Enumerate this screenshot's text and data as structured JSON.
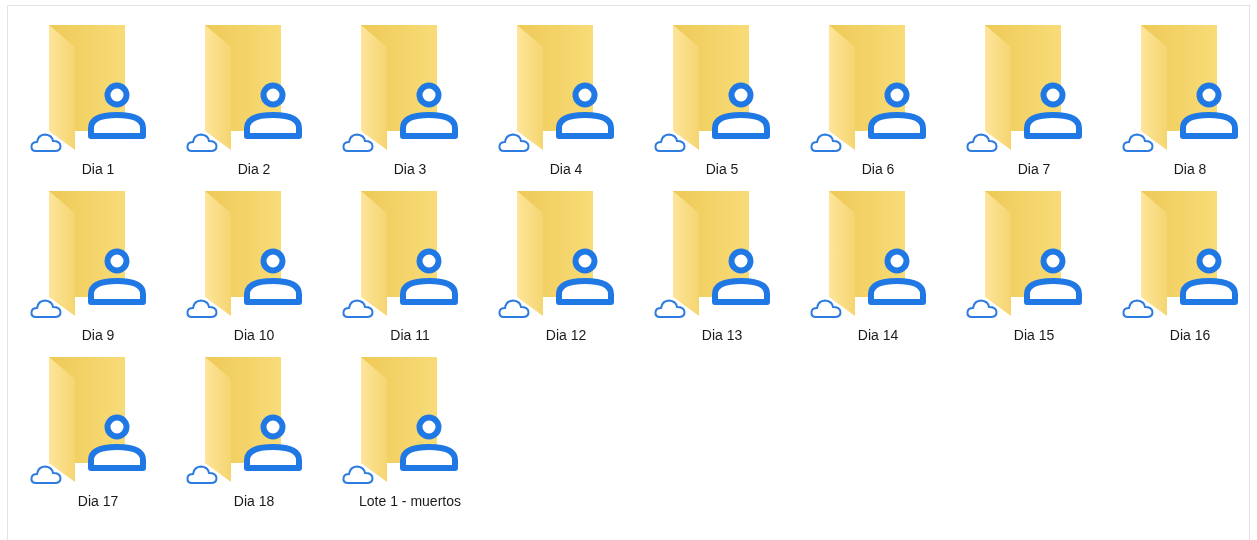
{
  "folders": [
    {
      "label": "Dia 1"
    },
    {
      "label": "Dia 2"
    },
    {
      "label": "Dia 3"
    },
    {
      "label": "Dia 4"
    },
    {
      "label": "Dia 5"
    },
    {
      "label": "Dia 6"
    },
    {
      "label": "Dia 7"
    },
    {
      "label": "Dia 8"
    },
    {
      "label": "Dia 9"
    },
    {
      "label": "Dia 10"
    },
    {
      "label": "Dia 11"
    },
    {
      "label": "Dia 12"
    },
    {
      "label": "Dia 13"
    },
    {
      "label": "Dia 14"
    },
    {
      "label": "Dia 15"
    },
    {
      "label": "Dia 16"
    },
    {
      "label": "Dia 17"
    },
    {
      "label": "Dia 18"
    },
    {
      "label": "Lote 1 - muertos"
    }
  ]
}
